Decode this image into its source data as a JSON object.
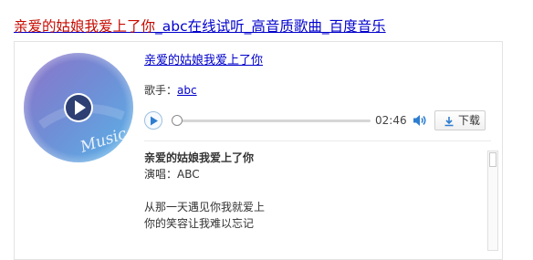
{
  "result": {
    "title_highlight": "亲爱的姑娘我爱上了你",
    "title_rest": "_abc在线试听_高音质歌曲_百度音乐"
  },
  "song": {
    "title": "亲爱的姑娘我爱上了你",
    "singer_label": "歌手：",
    "singer_name": "abc",
    "cover_text": "Music"
  },
  "player": {
    "time": "02:46",
    "progress": 0,
    "download_label": "下载",
    "icons": {
      "play": "play-icon",
      "volume": "volume-icon",
      "download": "download-icon"
    }
  },
  "lyrics": {
    "title": "亲爱的姑娘我爱上了你",
    "performer": "演唱：ABC",
    "lines": [
      "从那一天遇见你我就爱上",
      "你的笑容让我难以忘记"
    ]
  },
  "colors": {
    "link": "#0000cc",
    "highlight": "#c60a00",
    "accent": "#2e7ed0"
  }
}
